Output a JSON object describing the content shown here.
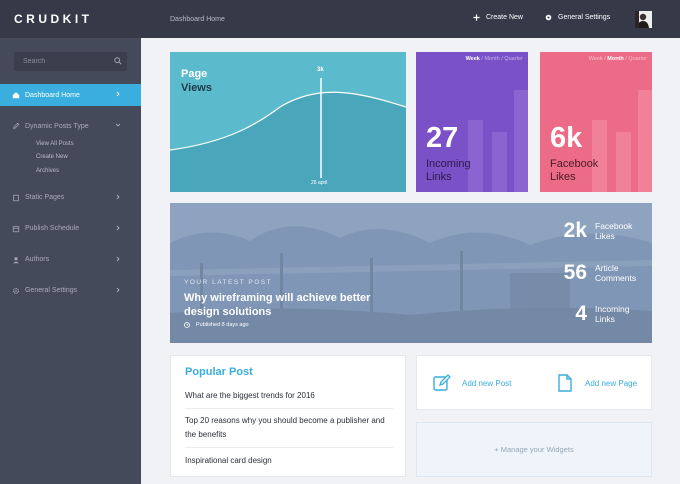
{
  "brand": "CRUDKIT",
  "search": {
    "placeholder": "Search"
  },
  "sidebar": {
    "items": [
      {
        "label": "Dashboard Home"
      },
      {
        "label": "Dynamic Posts Type",
        "sub": [
          "View All Posts",
          "Create New",
          "Archives"
        ]
      },
      {
        "label": "Static Pages"
      },
      {
        "label": "Publish Schedule"
      },
      {
        "label": "Authors"
      },
      {
        "label": "General Settings"
      }
    ]
  },
  "header": {
    "breadcrumb": "Dashboard Home",
    "create_new": "Create New",
    "general_settings": "General Settings"
  },
  "page_views": {
    "title_line1": "Page",
    "title_line2": "Views",
    "peak_value": "3k",
    "peak_date": "26 april"
  },
  "periods": [
    "Week",
    "Month",
    "Quarter"
  ],
  "incoming_links": {
    "value": "27",
    "label_line1": "Incoming",
    "label_line2": "Links",
    "active_period": "Week"
  },
  "facebook_likes": {
    "value": "6k",
    "label_line1": "Facebook",
    "label_line2": "Likes",
    "active_period": "Month"
  },
  "latest_post": {
    "kicker": "YOUR LATEST POST",
    "title": "Why wireframing will achieve better design solutions",
    "published": "Published 8 days ago",
    "stats": [
      {
        "value": "2k",
        "line1": "Facebook",
        "line2": "Likes"
      },
      {
        "value": "56",
        "line1": "Article",
        "line2": "Comments"
      },
      {
        "value": "4",
        "line1": "Incoming",
        "line2": "Links"
      }
    ]
  },
  "popular": {
    "heading": "Popular Post",
    "items": [
      "What are the biggest trends for 2016",
      "Top 20 reasons why you should become a publisher and the benefits",
      "Inspirational card design"
    ]
  },
  "actions": {
    "add_post": "Add new Post",
    "add_page": "Add new Page"
  },
  "widgets": {
    "label": "+ Manage your Widgets"
  },
  "colors": {
    "accent": "#3aaede",
    "sidebar": "#454a5b",
    "header": "#363a48",
    "purple": "#7b51c8",
    "pink": "#ec6c87",
    "teal": "#5bbacb"
  }
}
